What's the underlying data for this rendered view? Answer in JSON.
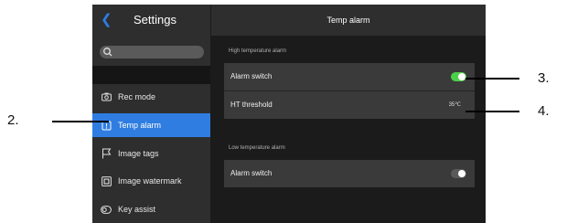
{
  "sidebar": {
    "title": "Settings",
    "search": {
      "placeholder": ""
    },
    "items": [
      {
        "label": "Rec mode",
        "icon": "camera-icon",
        "active": false
      },
      {
        "label": "Temp alarm",
        "icon": "alarm-icon",
        "active": true
      },
      {
        "label": "Image tags",
        "icon": "flag-icon",
        "active": false
      },
      {
        "label": "Image watermark",
        "icon": "watermark-icon",
        "active": false
      },
      {
        "label": "Key assist",
        "icon": "key-assist-icon",
        "active": false
      }
    ]
  },
  "main": {
    "title": "Temp alarm",
    "high_section": {
      "label": "High temperature alarm",
      "alarm_switch_label": "Alarm switch",
      "alarm_switch_on": true,
      "threshold_label": "HT threshold",
      "threshold_value": "35℃"
    },
    "low_section": {
      "label": "Low temperature alarm",
      "alarm_switch_label": "Alarm switch",
      "alarm_switch_on": false
    }
  },
  "callouts": {
    "c2": "2.",
    "c3": "3.",
    "c4": "4."
  },
  "colors": {
    "accent": "#2f7de1",
    "toggle_on": "#4cd04a",
    "toggle_off": "#5a5a5a",
    "panel_bg": "#1b1b1b",
    "sidebar_bg": "#2e2e2e",
    "row_bg": "#3a3a3a"
  }
}
